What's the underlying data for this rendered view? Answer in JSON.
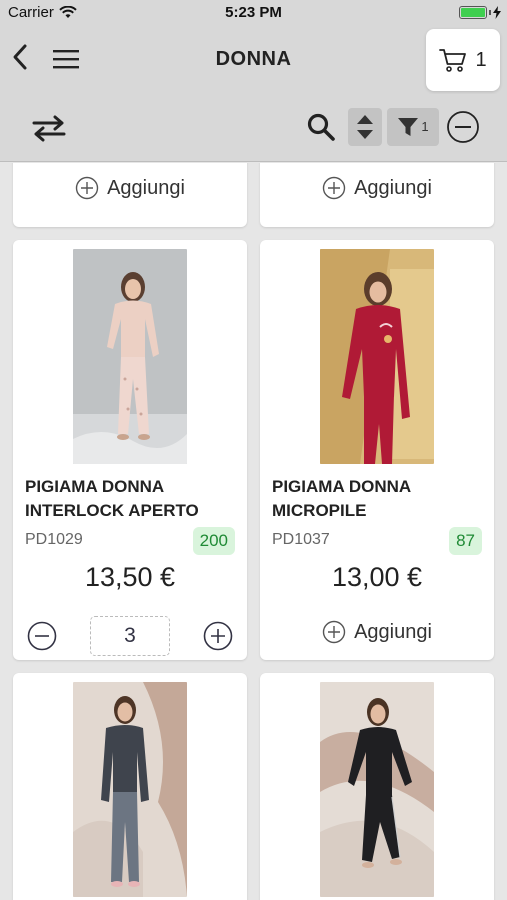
{
  "status_bar": {
    "carrier": "Carrier",
    "time": "5:23 PM"
  },
  "nav": {
    "title": "DONNA",
    "cart_count": "1"
  },
  "toolbar": {
    "filter_count": "1"
  },
  "top_row": [
    {
      "add_label": "Aggiungi"
    },
    {
      "add_label": "Aggiungi"
    }
  ],
  "products": [
    {
      "name": "PIGIAMA DONNA INTERLOCK APERTO",
      "code": "PD1029",
      "stock": "200",
      "price": "13,50 €",
      "quantity": "3"
    },
    {
      "name": "PIGIAMA DONNA MICROPILE",
      "code": "PD1037",
      "stock": "87",
      "price": "13,00 €",
      "add_label": "Aggiungi"
    }
  ],
  "colors": {
    "stock_bg": "#d9f4dc",
    "stock_text": "#1f8a35",
    "header_bg": "#d8d8d8"
  }
}
